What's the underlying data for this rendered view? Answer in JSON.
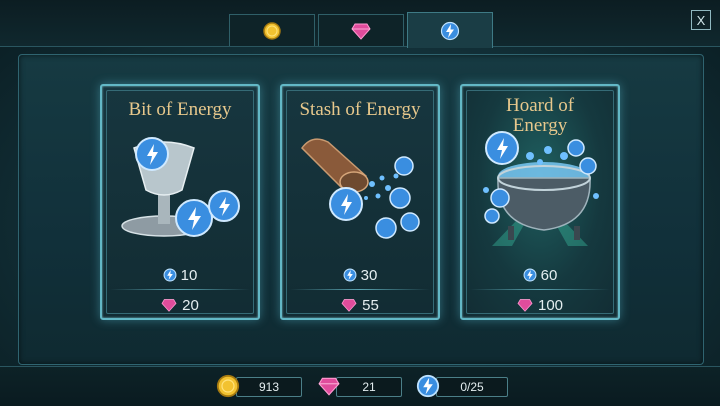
{
  "tabs": [
    {
      "icon": "gold-coin-icon"
    },
    {
      "icon": "gem-icon"
    },
    {
      "icon": "energy-icon"
    }
  ],
  "active_tab": 2,
  "close_label": "X",
  "cards": [
    {
      "title": "Bit of Energy",
      "energy": "10",
      "price": "20"
    },
    {
      "title": "Stash of Energy",
      "energy": "30",
      "price": "55"
    },
    {
      "title_line1": "Hoard of",
      "title_line2": "Energy",
      "energy": "60",
      "price": "100"
    }
  ],
  "balances": {
    "coins": "913",
    "gems": "21",
    "energy": "0/25"
  },
  "colors": {
    "gold": "#f2c230",
    "gem": "#e04c9c",
    "energy": "#4aa8f0",
    "title": "#e7c88c",
    "card_border": "#63b8c6"
  }
}
